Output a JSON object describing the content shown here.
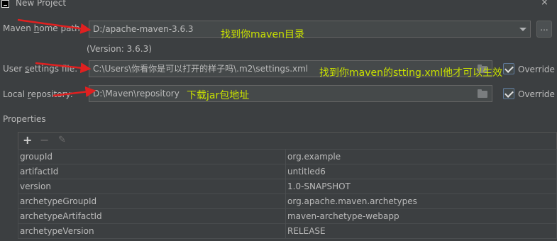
{
  "window": {
    "title": "New Project",
    "close_symbol": "×"
  },
  "maven_home": {
    "label_pre": "Maven ",
    "label_mnemonic": "h",
    "label_post": "ome path:",
    "value": "D:/apache-maven-3.6.3",
    "version": "(Version: 3.6.3)",
    "browse_label": "..."
  },
  "user_settings": {
    "label_pre": "User ",
    "label_mnemonic": "s",
    "label_post": "ettings file:",
    "value": "C:\\Users\\你看你是可以打开的样子吗\\.m2\\settings.xml",
    "override_label": "Override",
    "override_checked": true
  },
  "local_repo": {
    "label_pre": "Local ",
    "label_mnemonic": "r",
    "label_post": "epository:",
    "value": "D:\\Maven\\repository",
    "override_label": "Override",
    "override_checked": true
  },
  "annotations": {
    "maven_home": "找到你maven目录",
    "settings": "找到你maven的stting.xml他才可以生效",
    "repo": "下载jar包地址"
  },
  "properties": {
    "section_label": "Properties",
    "toolbar": {
      "add": "+",
      "remove": "−",
      "edit": "✎"
    },
    "rows": [
      {
        "key": "groupId",
        "value": "org.example"
      },
      {
        "key": "artifactId",
        "value": "untitled6"
      },
      {
        "key": "version",
        "value": "1.0-SNAPSHOT"
      },
      {
        "key": "archetypeGroupId",
        "value": "org.apache.maven.archetypes"
      },
      {
        "key": "archetypeArtifactId",
        "value": "maven-archetype-webapp"
      },
      {
        "key": "archetypeVersion",
        "value": "RELEASE"
      }
    ]
  },
  "colors": {
    "annotation": "#c8e000",
    "arrow": "#e02020",
    "background": "#3c3f41"
  }
}
